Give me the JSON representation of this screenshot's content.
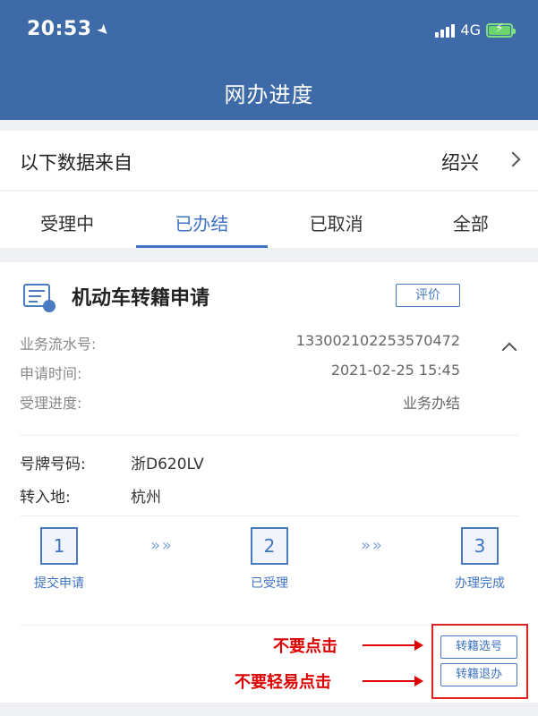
{
  "status_bar": {
    "time": "20:53",
    "network": "4G"
  },
  "header": {
    "title": "网办进度"
  },
  "source": {
    "label": "以下数据来自",
    "value": "绍兴"
  },
  "tabs": [
    {
      "label": "受理中"
    },
    {
      "label": "已办结"
    },
    {
      "label": "已取消"
    },
    {
      "label": "全部"
    }
  ],
  "card": {
    "title": "机动车转籍申请",
    "rate_label": "评价",
    "info": [
      {
        "label": "业务流水号:",
        "value": "133002102253570472"
      },
      {
        "label": "申请时间:",
        "value": "2021-02-25 15:45"
      },
      {
        "label": "受理进度:",
        "value": "业务办结"
      }
    ],
    "details": [
      {
        "label": "号牌号码:",
        "value": "浙D620LV"
      },
      {
        "label": "转入地:",
        "value": "杭州"
      }
    ],
    "steps": [
      {
        "number": "1",
        "label": "提交申请"
      },
      {
        "number": "2",
        "label": "已受理"
      },
      {
        "number": "3",
        "label": "办理完成"
      }
    ],
    "actions": {
      "select_number": "转籍选号",
      "withdraw": "转籍退办"
    }
  },
  "annotations": {
    "warning1": "不要点击",
    "warning2": "不要轻易点击"
  },
  "colors": {
    "header_bg": "#3f6aa8",
    "accent": "#3f73c4",
    "warning": "#dd0000"
  },
  "icons": [
    "location-arrow-icon",
    "signal-icon",
    "battery-charging-icon",
    "chevron-right-icon",
    "document-icon",
    "chevron-up-icon",
    "double-chevron-icon"
  ]
}
